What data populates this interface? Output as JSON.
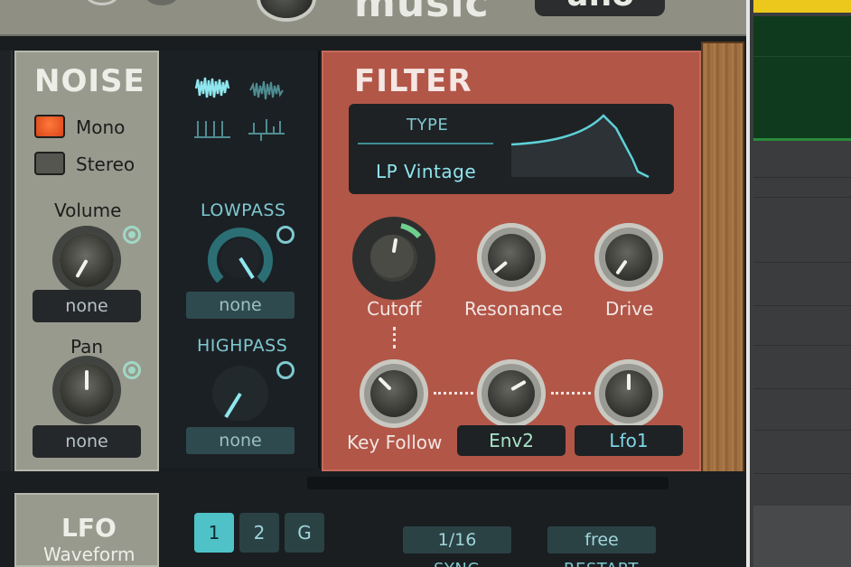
{
  "header": {
    "logo_text": "music",
    "badge_text": "uno"
  },
  "noise": {
    "title": "NOISE",
    "mono_label": "Mono",
    "stereo_label": "Stereo",
    "volume_label": "Volume",
    "volume_mod": "none",
    "pan_label": "Pan",
    "pan_mod": "none",
    "mono_active": true
  },
  "noise_type": {
    "waveforms": [
      "white-noise-icon",
      "pink-noise-icon",
      "impulse-icon",
      "crackle-icon"
    ],
    "lowpass_label": "LOWPASS",
    "lowpass_mod": "none",
    "highpass_label": "HIGHPASS",
    "highpass_mod": "none"
  },
  "filter": {
    "title": "FILTER",
    "type_label": "TYPE",
    "type_value": "LP Vintage",
    "cutoff_label": "Cutoff",
    "resonance_label": "Resonance",
    "drive_label": "Drive",
    "keyfollow_label": "Key Follow",
    "env_mod": "Env2",
    "lfo_mod": "Lfo1"
  },
  "lfo": {
    "title": "LFO",
    "subtitle": "Waveform",
    "tabs": [
      "1",
      "2",
      "G"
    ],
    "active_tab": "1",
    "sync_value": "1/16",
    "sync_label": "SYNC",
    "restart_value": "free",
    "restart_label": "RESTART"
  },
  "colors": {
    "accent_teal": "#45b8c0",
    "filter_bg": "#b25648",
    "noise_bg": "#999a8e",
    "led_on": "#e8521c"
  }
}
